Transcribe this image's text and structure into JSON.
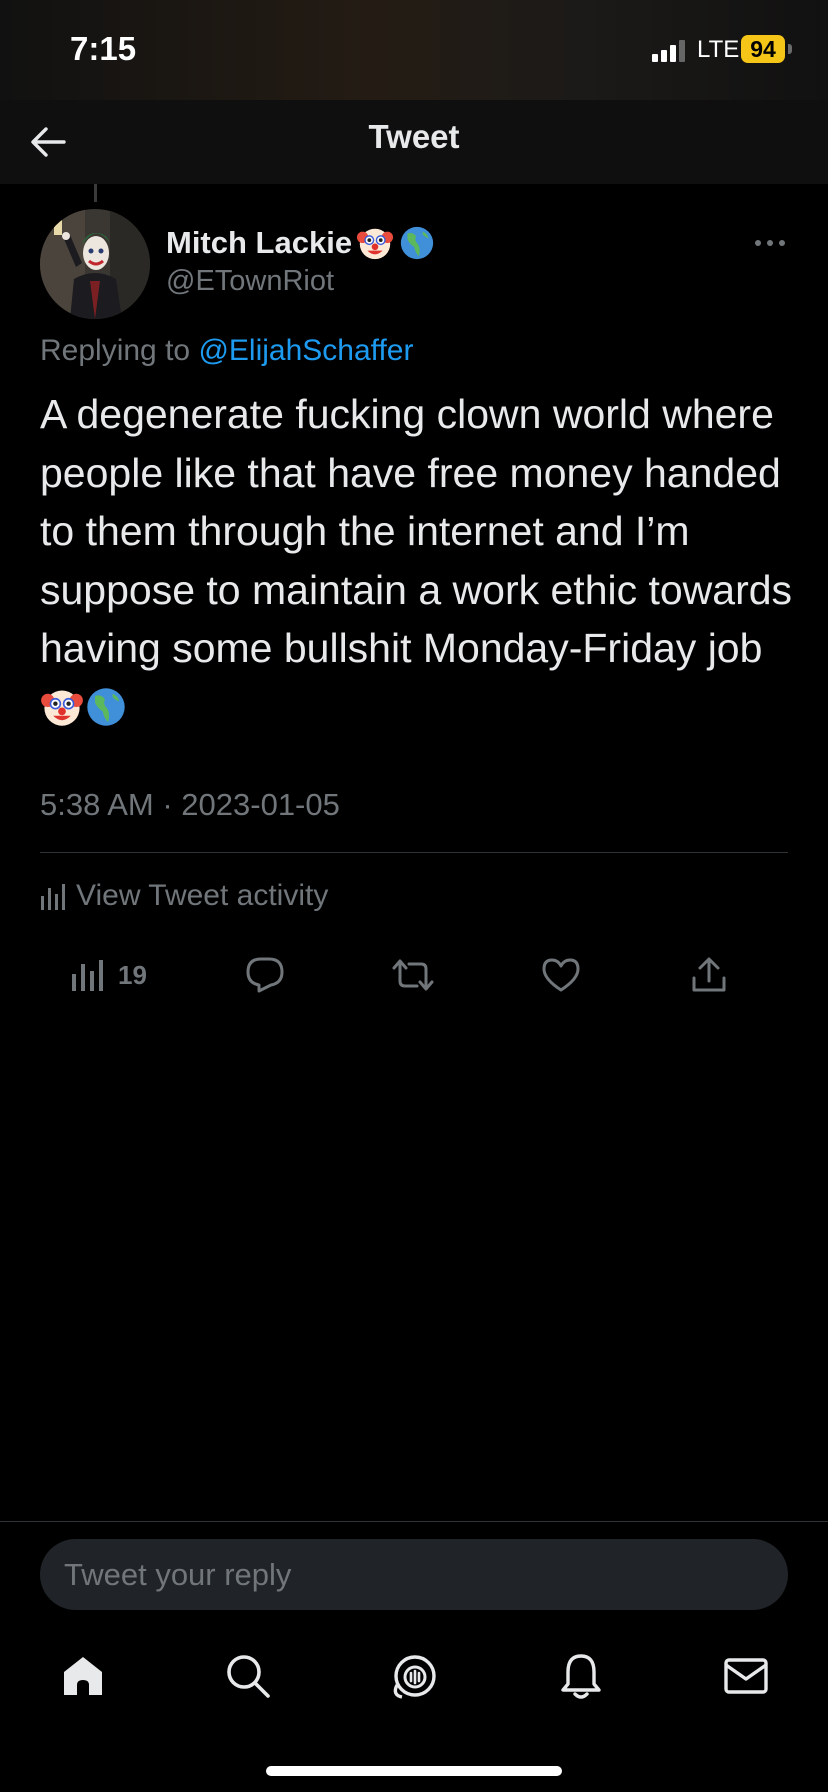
{
  "status_bar": {
    "time": "7:15",
    "network": "LTE",
    "battery": "94"
  },
  "header": {
    "title": "Tweet"
  },
  "tweet": {
    "author_name": "Mitch Lackie",
    "author_handle": "@ETownRiot",
    "replying_prefix": "Replying to ",
    "replying_to": "@ElijahSchaffer",
    "text": "A degenerate fucking clown world where people like that have free money handed to them through the internet and I’m suppose to maintain a work ethic towards having some bullshit Monday-Friday job",
    "timestamp": "5:38 AM · 2023-01-05",
    "activity_label": "View Tweet activity",
    "views": "19"
  },
  "reply_box": {
    "placeholder": "Tweet your reply"
  },
  "icons": {
    "name_emojis": [
      "clown-face-emoji",
      "globe-americas-emoji"
    ],
    "nav": [
      "home-icon",
      "search-icon",
      "spaces-icon",
      "notifications-icon",
      "messages-icon"
    ]
  },
  "colors": {
    "accent": "#1d9bf0",
    "muted": "#71767b",
    "text": "#e7e9ea",
    "battery": "#f5c518"
  }
}
